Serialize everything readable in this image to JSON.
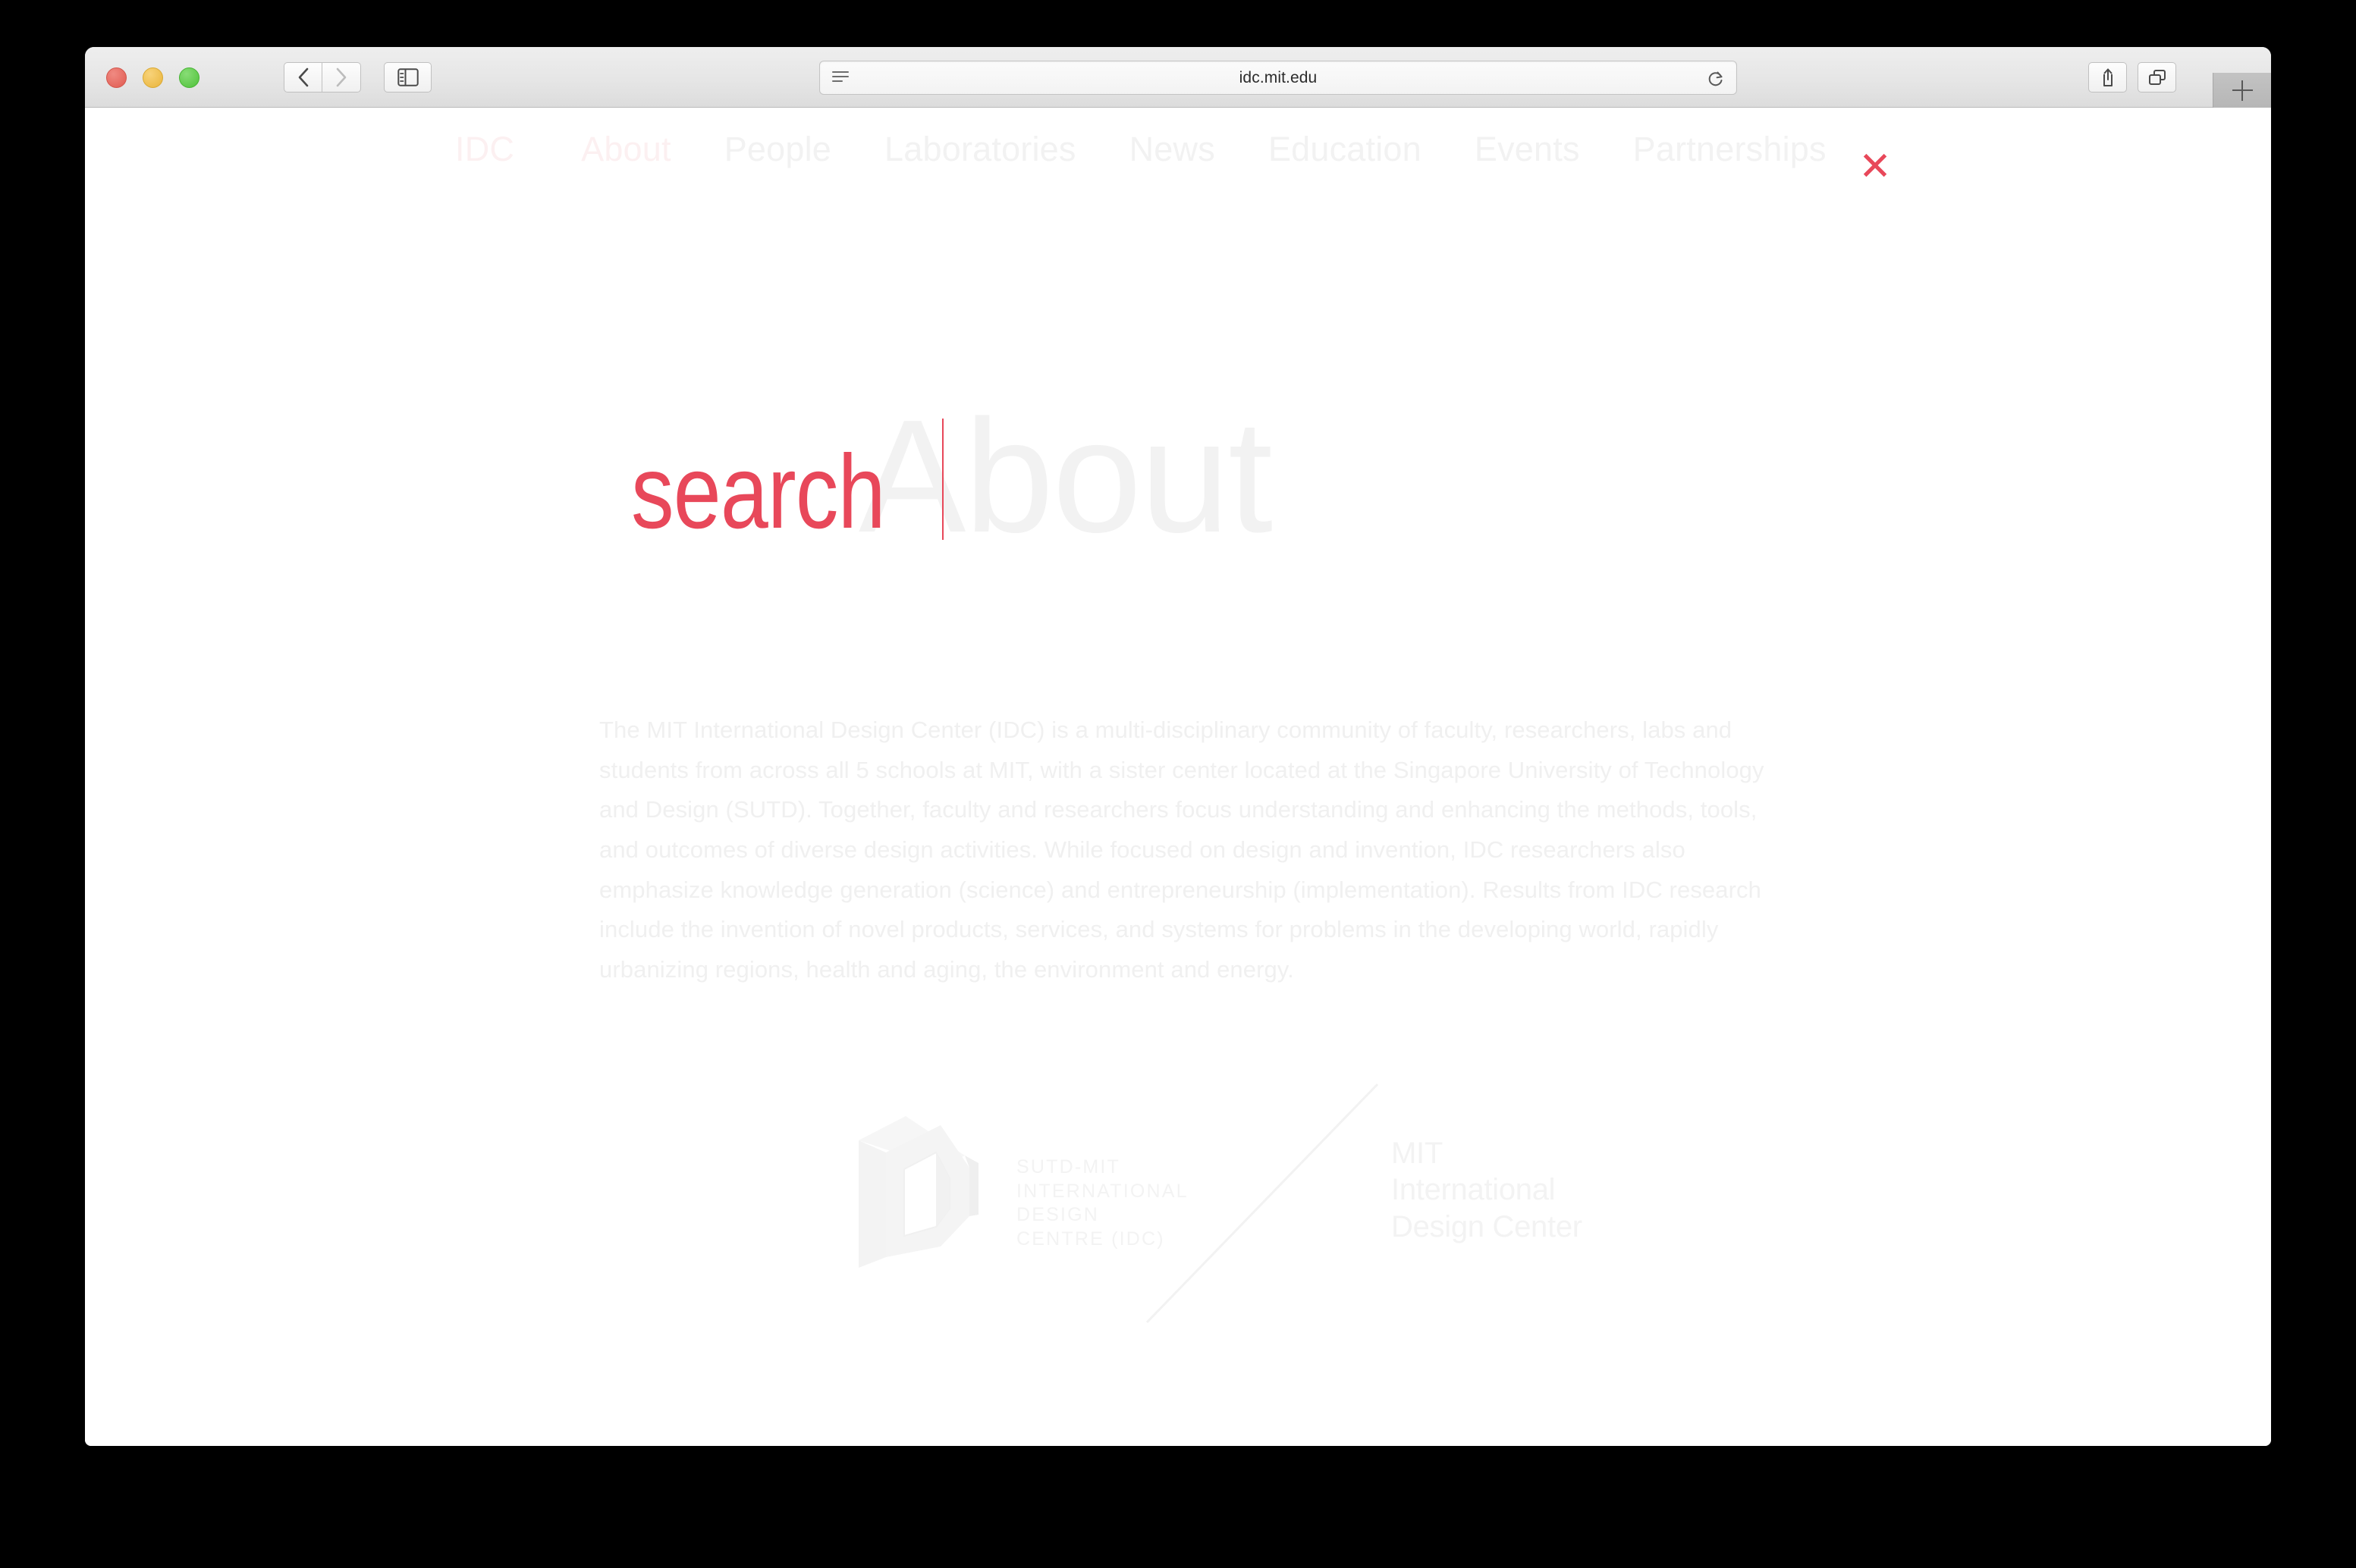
{
  "browser": {
    "url": "idc.mit.edu",
    "traffic_lights": [
      "close",
      "minimize",
      "maximize"
    ],
    "back_label": "‹",
    "forward_label": "›",
    "icons": {
      "sidebar": "sidebar-icon",
      "reader": "reader-icon",
      "reload": "reload-icon",
      "share": "share-icon",
      "tabs": "show-tabs-icon",
      "new_tab": "plus-icon"
    }
  },
  "site_nav": {
    "brand": "IDC",
    "items": [
      {
        "label": "About",
        "active": true
      },
      {
        "label": "People",
        "active": false
      },
      {
        "label": "Laboratories",
        "active": false
      },
      {
        "label": "News",
        "active": false
      },
      {
        "label": "Education",
        "active": false
      },
      {
        "label": "Events",
        "active": false
      },
      {
        "label": "Partnerships",
        "active": false
      }
    ],
    "close_label": "✕"
  },
  "hero": {
    "page_title": "About",
    "search_value": "search",
    "search_placeholder": "search"
  },
  "content": {
    "paragraph": "The MIT International Design Center (IDC) is a multi-disciplinary community of faculty, researchers, labs and students from across all 5 schools at MIT, with a sister center located at the Singapore University of Technology and Design (SUTD). Together, faculty and researchers focus understanding and enhancing the methods, tools, and outcomes of diverse design activities. While focused on design and invention, IDC researchers also emphasize knowledge generation (science) and entrepreneurship (implementation). Results from IDC research include the invention of novel products, services, and systems for problems in the developing world, rapidly urbanizing regions, health and aging, the environment and energy."
  },
  "footer": {
    "sutd_logo": {
      "mark": "idc-d-mark-icon",
      "line1": "SUTD-MIT",
      "line2": "INTERNATIONAL",
      "line3": "DESIGN",
      "line4": "CENTRE (IDC)"
    },
    "mit_logo": {
      "line1": "MIT",
      "line2": "International",
      "line3": "Design Center"
    }
  },
  "colors": {
    "accent_red": "#E8485A",
    "faded_text": "#F0F0F0",
    "faded_pink": "#FCF0F1",
    "page_bg": "#FFFFFF",
    "desktop_bg": "#000000",
    "toolbar_bg": "#E6E6E6"
  }
}
